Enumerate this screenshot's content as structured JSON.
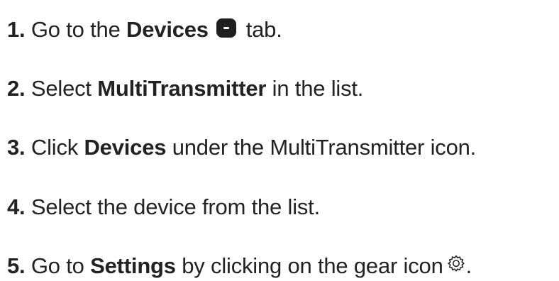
{
  "steps": [
    {
      "number": "1.",
      "before": "Go to the",
      "strong": "Devices",
      "after": "tab.",
      "icon": "device-tab-icon"
    },
    {
      "number": "2.",
      "before": "Select",
      "strong": "MultiTransmitter",
      "after": "in the list."
    },
    {
      "number": "3.",
      "before": "Click",
      "strong": "Devices",
      "after": "under the MultiTransmitter icon."
    },
    {
      "number": "4.",
      "text": "Select the device from the list."
    },
    {
      "number": "5.",
      "before": "Go to",
      "strong": "Settings",
      "after": "by clicking on the gear icon",
      "icon": "gear-icon",
      "trailing": "."
    }
  ]
}
